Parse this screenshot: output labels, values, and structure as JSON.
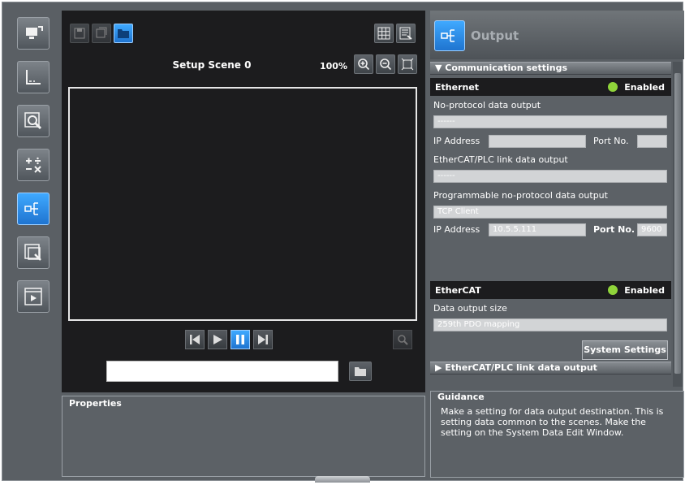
{
  "left_toolbar": {
    "items": [
      {
        "icon": "camera-display-icon"
      },
      {
        "icon": "graph-axis-icon"
      },
      {
        "icon": "zoom-inspect-icon"
      },
      {
        "icon": "arithmetic-icon"
      },
      {
        "icon": "output-flow-icon",
        "active": true
      },
      {
        "icon": "image-window-icon"
      },
      {
        "icon": "run-window-icon"
      }
    ]
  },
  "scene": {
    "title": "Setup Scene 0",
    "zoom": "100%"
  },
  "properties": {
    "title": "Properties"
  },
  "output_panel": {
    "title": "Output",
    "communication_settings_label": "▼ Communication settings",
    "ethernet": {
      "label": "Ethernet",
      "status": "Enabled",
      "no_protocol_label": "No-protocol data output",
      "no_protocol_value": "------",
      "ip_label": "IP Address",
      "port_label": "Port No.",
      "ethercat_plc_label": "EtherCAT/PLC link data output",
      "ethercat_plc_value": "------",
      "prog_label": "Programmable no-protocol data output",
      "prog_mode": "TCP Client",
      "prog_ip_label": "IP Address",
      "prog_ip_value": "10.5.5.111",
      "prog_port_label": "Port No.",
      "prog_port_value": "9600"
    },
    "ethercat": {
      "label": "EtherCAT",
      "status": "Enabled",
      "data_output_size_label": "Data output size",
      "data_output_size_value": "259th PDO mapping"
    },
    "system_settings_button": "System Settings",
    "ethercat_plc_section_label": "▶ EtherCAT/PLC link data output"
  },
  "guidance": {
    "title": "Guidance",
    "text": "Make a setting for data output destination. This is setting data common to the scenes. Make the setting on the System Data Edit Window."
  },
  "colors": {
    "accent": "#2e8ff0",
    "status_enabled": "#8fd43a",
    "panel_bg": "#5c6166",
    "viewer_bg": "#1c1c1e"
  }
}
